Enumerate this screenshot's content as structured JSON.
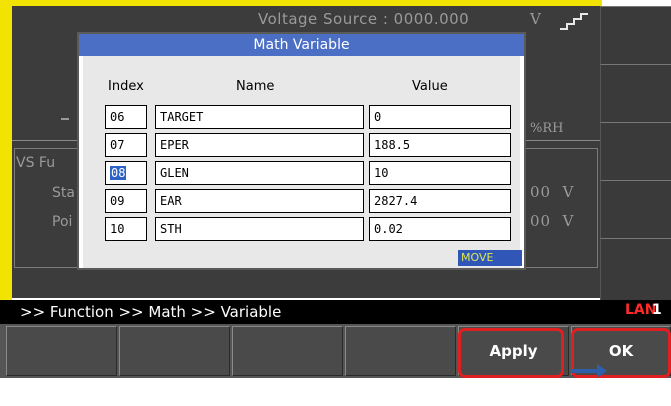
{
  "background": {
    "voltage_source_label": "Voltage Source :",
    "voltage_source_value": "0000.000",
    "voltage_unit": "V",
    "humidity_unit": "%RH",
    "panel_title": "VS Fu",
    "row1_label": "Sta",
    "row1_value": "00",
    "row1_unit": "V",
    "row2_label": "Poi",
    "row2_value": "00",
    "row2_unit": "V"
  },
  "dialog": {
    "title": "Math Variable",
    "headers": {
      "index": "Index",
      "name": "Name",
      "value": "Value"
    },
    "rows": [
      {
        "index": "06",
        "name": "TARGET",
        "value": "0"
      },
      {
        "index": "07",
        "name": "EPER",
        "value": "188.5"
      },
      {
        "index": "08",
        "name": "GLEN",
        "value": "10",
        "selected": true
      },
      {
        "index": "09",
        "name": "EAR",
        "value": "2827.4"
      },
      {
        "index": "10",
        "name": "STH",
        "value": "0.02"
      }
    ],
    "move_label": "MOVE"
  },
  "status": {
    "breadcrumb": ">> Function >> Math >> Variable",
    "interface": "LAN",
    "channel": "1"
  },
  "softkeys": {
    "apply_label": "Apply",
    "ok_label": "OK"
  },
  "colors": {
    "accent_yellow": "#f2e400",
    "dialog_title_bg": "#4a6fc4",
    "selection_bg": "#2f62c6",
    "highlight_red": "#e02020",
    "arrow_blue": "#2f5fa8"
  },
  "icons": {
    "output_waveform": "staircase-waveform-icon",
    "annotation_arrow": "right-arrow-icon"
  }
}
